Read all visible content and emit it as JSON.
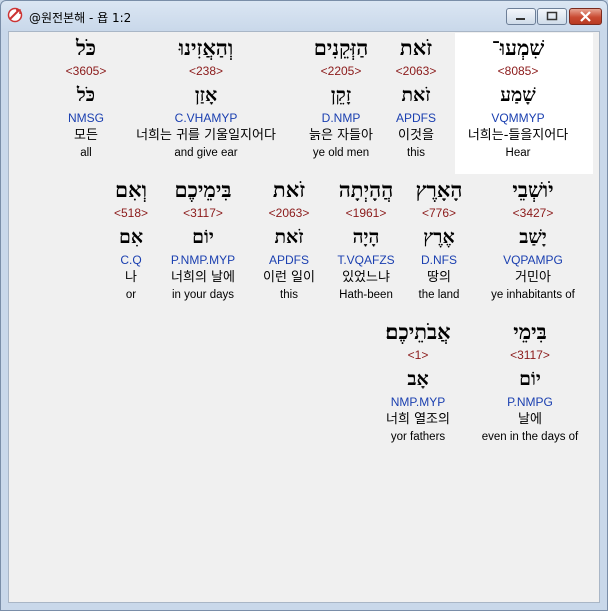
{
  "window": {
    "title": "@원전본해 - 욥 1:2"
  },
  "rows": [
    [
      {
        "heb": "כֹּל",
        "strong": "<3605>",
        "root": "כֹּל",
        "morph": "NMSG",
        "kor": "모든",
        "eng": "all"
      },
      {
        "heb": "וְהַאֲזִינוּ",
        "strong": "<238>",
        "root": "אָזַן",
        "morph": "C.VHAMYP",
        "kor": "너희는 귀를 기울일지어다",
        "eng": "and give ear"
      },
      {
        "heb": "הַזְּקֵנִים",
        "strong": "<2205>",
        "root": "זָקֵן",
        "morph": "D.NMP",
        "kor": "늙은 자들아",
        "eng": "ye old men"
      },
      {
        "heb": "זֹאת",
        "strong": "<2063>",
        "root": "זֹאת",
        "morph": "APDFS",
        "kor": "이것을",
        "eng": "this"
      },
      {
        "heb": "שִׁמְעוּ־",
        "strong": "<8085>",
        "root": "שָׁמַע",
        "morph": "VQMMYP",
        "kor": "너희는-들을지어다",
        "eng": "Hear"
      }
    ],
    [
      {
        "heb": "וְאִם",
        "strong": "<518>",
        "root": "אִם",
        "morph": "C.Q",
        "kor": "나",
        "eng": "or"
      },
      {
        "heb": "בִּימֵיכֶם",
        "strong": "<3117>",
        "root": "יוֹם",
        "morph": "P.NMP.MYP",
        "kor": "너희의 날에",
        "eng": "in your days"
      },
      {
        "heb": "זֹאת",
        "strong": "<2063>",
        "root": "זֹאת",
        "morph": "APDFS",
        "kor": "이런 일이",
        "eng": "this"
      },
      {
        "heb": "הֲהָיְתָה",
        "strong": "<1961>",
        "root": "הָיָה",
        "morph": "T.VQAFZS",
        "kor": "있었느냐",
        "eng": "Hath-been"
      },
      {
        "heb": "הָאָרֶץ",
        "strong": "<776>",
        "root": "אֶרֶץ",
        "morph": "D.NFS",
        "kor": "땅의",
        "eng": "the land"
      },
      {
        "heb": "יֹושְׁבֵי",
        "strong": "<3427>",
        "root": "יָשַׁב",
        "morph": "VQPAMPG",
        "kor": "거민아",
        "eng": "ye inhabitants of"
      }
    ],
    [
      {
        "heb": "אֲבֹתֵיכֶם׃",
        "strong": "<1>",
        "root": "אָב",
        "morph": "NMP.MYP",
        "kor": "너희 열조의",
        "eng": "yor fathers"
      },
      {
        "heb": "בִּימֵי",
        "strong": "<3117>",
        "root": "יוֹם",
        "morph": "P.NMPG",
        "kor": "날에",
        "eng": "even in the days of"
      }
    ]
  ]
}
